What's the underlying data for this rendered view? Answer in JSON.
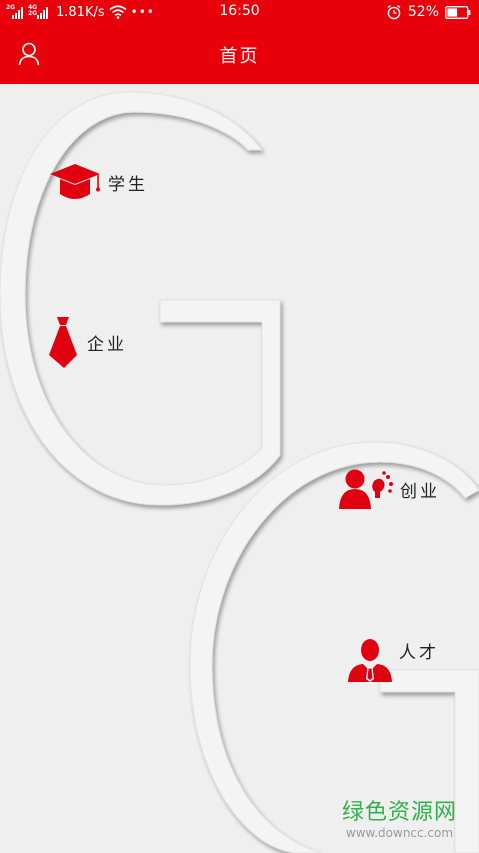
{
  "status_bar": {
    "network_1": "2G",
    "network_2_top": "4G",
    "network_2_bottom": "2G",
    "speed": "1.81K/s",
    "wifi_icon": "wifi-icon",
    "more_icon": "more-dots-icon",
    "time": "16:50",
    "alarm_icon": "alarm-clock-icon",
    "battery_percent": "52%",
    "battery_level": 0.52
  },
  "title_bar": {
    "title": "首页",
    "user_icon": "user-icon",
    "background_color": "#e8000b"
  },
  "menu": {
    "student": {
      "label": "学生",
      "icon": "graduation-cap-icon"
    },
    "company": {
      "label": "企业",
      "icon": "necktie-icon"
    },
    "startup": {
      "label": "创业",
      "icon": "person-idea-icon"
    },
    "talent": {
      "label": "人才",
      "icon": "businessman-icon"
    }
  },
  "colors": {
    "accent": "#e8000b",
    "background": "#efefef",
    "icon_red": "#e00010"
  },
  "watermark": {
    "title": "绿色资源网",
    "url": "www.downcc.com"
  }
}
